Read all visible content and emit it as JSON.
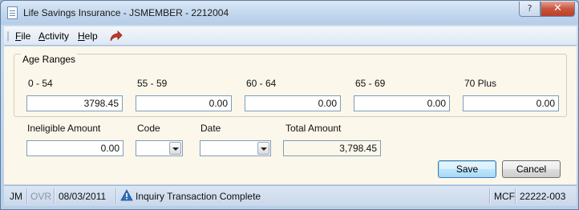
{
  "window": {
    "title": "Life Savings Insurance - JSMEMBER - 2212004",
    "help_glyph": "?",
    "close_glyph": "✕"
  },
  "menu": {
    "items": [
      "File",
      "Activity",
      "Help"
    ]
  },
  "age_ranges": {
    "legend": "Age Ranges",
    "ranges": [
      {
        "label": "0 - 54",
        "value": "3798.45"
      },
      {
        "label": "55 - 59",
        "value": "0.00"
      },
      {
        "label": "60 - 64",
        "value": "0.00"
      },
      {
        "label": "65 - 69",
        "value": "0.00"
      },
      {
        "label": "70 Plus",
        "value": "0.00"
      }
    ]
  },
  "details": {
    "ineligible_label": "Ineligible Amount",
    "ineligible_value": "0.00",
    "code_label": "Code",
    "code_value": "",
    "date_label": "Date",
    "date_value": "",
    "total_label": "Total Amount",
    "total_value": "3,798.45"
  },
  "buttons": {
    "save": "Save",
    "cancel": "Cancel"
  },
  "status": {
    "user": "JM",
    "mode": "OVR",
    "date": "08/03/2011",
    "message": "Inquiry Transaction Complete",
    "code": "MCF",
    "account": "22222-003"
  }
}
